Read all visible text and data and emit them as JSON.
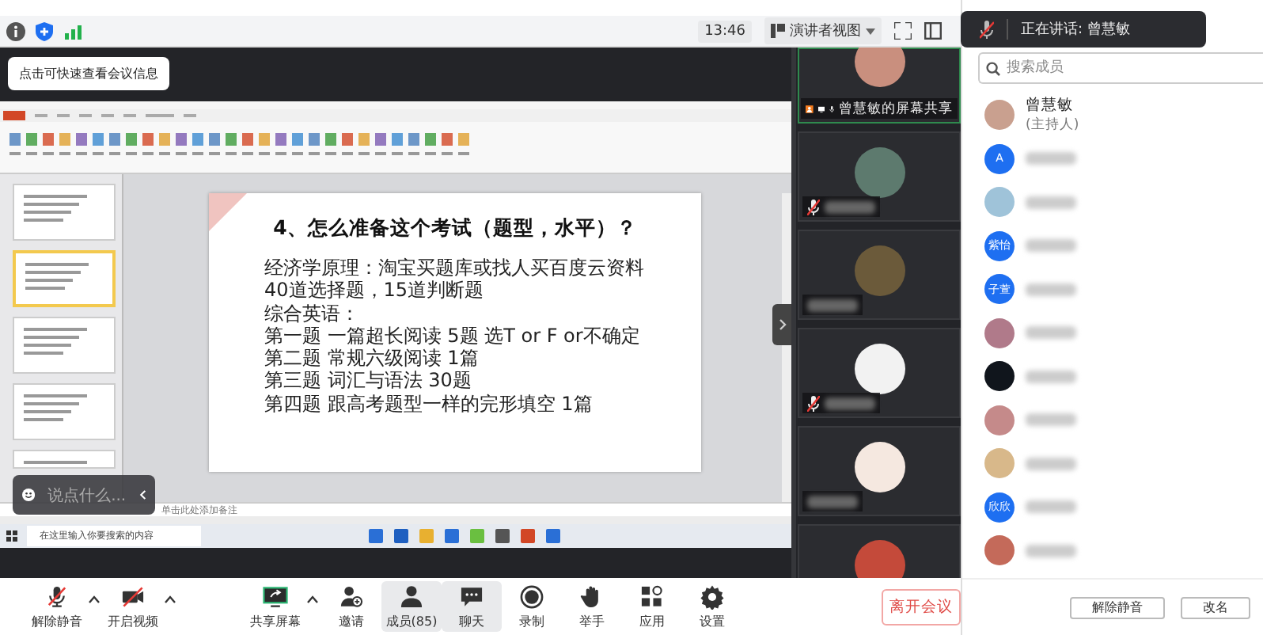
{
  "tooltip": "点击可快速查看会议信息",
  "toolbar": {
    "time": "13:46",
    "view_mode": "演讲者视图"
  },
  "speaking_banner": {
    "label": "正在讲话: 曾慧敏"
  },
  "share": {
    "thumbnails": [
      {
        "selected": false
      },
      {
        "selected": true
      },
      {
        "selected": false
      },
      {
        "selected": false
      },
      {
        "selected": false
      }
    ],
    "slide": {
      "title": "4、怎么准备这个考试（题型，水平）？",
      "lines": [
        "经济学原理：淘宝买题库或找人买百度云资料",
        "40道选择题，15道判断题",
        "综合英语：",
        "第一题 一篇超长阅读 5题 选T or F or不确定",
        "第二题 常规六级阅读 1篇",
        "第三题 词汇与语法 30题",
        "第四题 跟高考题型一样的完形填空 1篇"
      ]
    },
    "notes_placeholder": "单击此处添加备注",
    "taskbar_search": "在这里输入你要搜索的内容",
    "chat_placeholder": "说点什么..."
  },
  "tiles": [
    {
      "label": "曾慧敏的屏幕共享",
      "muted": false,
      "color": "#c98f7e"
    },
    {
      "muted": true,
      "color": "#5d7a6e"
    },
    {
      "muted": false,
      "color": "#6b5a3a"
    },
    {
      "muted": true,
      "color": "#f2f2f2"
    },
    {
      "muted": false,
      "color": "#f5e8e0"
    },
    {
      "color": "#c44a3a"
    }
  ],
  "controls": [
    {
      "kind": "mic_muted",
      "label": "解除静音",
      "menu": true,
      "selected": false
    },
    {
      "kind": "video_off",
      "label": "开启视频",
      "menu": true,
      "selected": false
    },
    {
      "kind": "share",
      "label": "共享屏幕",
      "menu": true,
      "selected": false
    },
    {
      "kind": "invite",
      "label": "邀请",
      "menu": false,
      "selected": false
    },
    {
      "kind": "members",
      "label": "成员(85)",
      "menu": false,
      "selected": true
    },
    {
      "kind": "chat",
      "label": "聊天",
      "menu": false,
      "selected": true
    },
    {
      "kind": "record",
      "label": "录制",
      "menu": false,
      "selected": false
    },
    {
      "kind": "hand",
      "label": "举手",
      "menu": false,
      "selected": false
    },
    {
      "kind": "apps",
      "label": "应用",
      "menu": false,
      "selected": false
    },
    {
      "kind": "settings",
      "label": "设置",
      "menu": false,
      "selected": false
    }
  ],
  "leave_button": "离开会议",
  "members": {
    "search_placeholder": "搜索成员",
    "items": [
      {
        "name": "曾慧敏",
        "role": "(主持人)",
        "color": "#c9a08f"
      },
      {
        "avatar_text": "A",
        "color": "#1e6ff1"
      },
      {
        "color": "#9fc3d9"
      },
      {
        "avatar_text": "紫怡",
        "color": "#1e6ff1"
      },
      {
        "avatar_text": "子萱",
        "color": "#1e6ff1"
      },
      {
        "color": "#b07a8a"
      },
      {
        "color": "#10151c"
      },
      {
        "color": "#c58a8a"
      },
      {
        "color": "#d8b88a"
      },
      {
        "avatar_text": "欣欣",
        "color": "#1e6ff1"
      },
      {
        "color": "#c46a5a"
      }
    ],
    "buttons": [
      "解除静音",
      "改名"
    ]
  }
}
